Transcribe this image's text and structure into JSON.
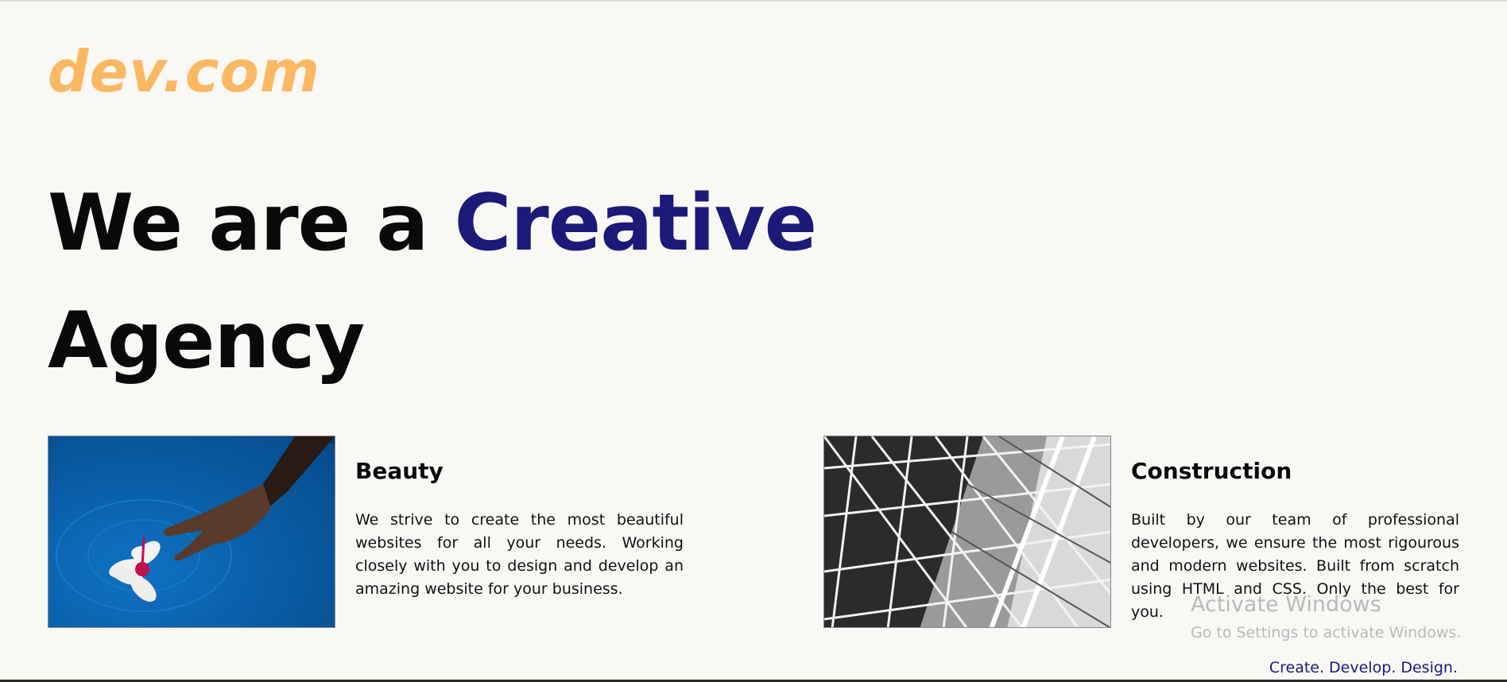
{
  "header": {
    "logo": "dev.com"
  },
  "hero": {
    "line1_prefix": "We are a",
    "line1_accent": "Creative",
    "line2": "Agency"
  },
  "cards": [
    {
      "title": "Beauty",
      "description": "We strive to create the most beautiful websites for all your needs. Working closely with you to design and develop an amazing website for your business."
    },
    {
      "title": "Construction",
      "description": "Built by our team of professional developers, we ensure the most rigourous and modern websites. Built from scratch using HTML and CSS. Only the best for you."
    }
  ],
  "footer": {
    "tagline": "Create. Develop. Design."
  },
  "system": {
    "activate_title": "Activate Windows",
    "activate_subtitle": "Go to Settings to activate Windows."
  },
  "colors": {
    "logo": "#fbb862",
    "accent": "#1c1a78",
    "text": "#0a0a0a",
    "background": "#f9f8f5"
  }
}
